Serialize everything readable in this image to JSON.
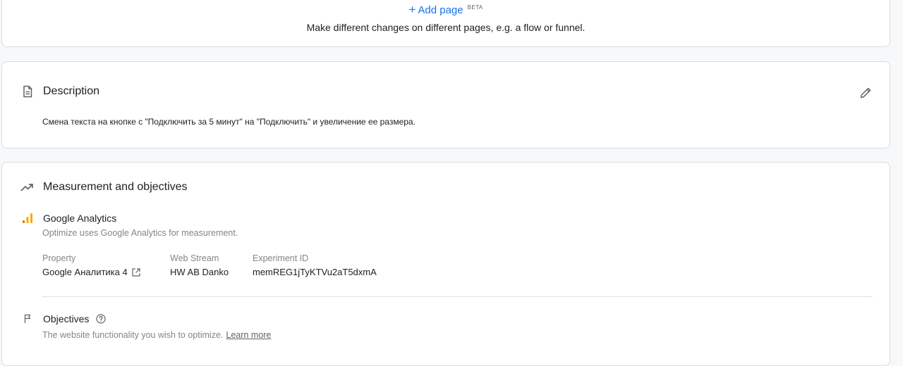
{
  "add_page": {
    "plus": "+",
    "label": "Add page",
    "badge": "BETA",
    "help": "Make different changes on different pages, e.g. a flow or funnel."
  },
  "description": {
    "title": "Description",
    "text": "Смена текста на кнопке с \"Подключить за 5 минут\" на \"Подключить\" и увеличение ее размера.",
    "icon": "document-icon",
    "edit_icon": "pencil-icon"
  },
  "measurement": {
    "title": "Measurement and objectives",
    "icon": "trending-up-icon",
    "analytics": {
      "title": "Google Analytics",
      "subtitle": "Optimize uses Google Analytics for measurement.",
      "icon": "analytics-bars-icon",
      "fields": [
        {
          "label": "Property",
          "value": "Google Аналитика 4"
        },
        {
          "label": "Web Stream",
          "value": "HW AB Danko"
        },
        {
          "label": "Experiment ID",
          "value": "memREG1jTyKTVu2aT5dxmA"
        }
      ]
    },
    "objectives": {
      "title": "Objectives",
      "subtitle": "The website functionality you wish to optimize.",
      "link": "Learn more",
      "icon": "flag-icon"
    }
  },
  "colors": {
    "accent": "#1a73e8",
    "analytics_orange": "#f9ab00",
    "analytics_dark_orange": "#e37400",
    "muted_text": "#80868b"
  }
}
